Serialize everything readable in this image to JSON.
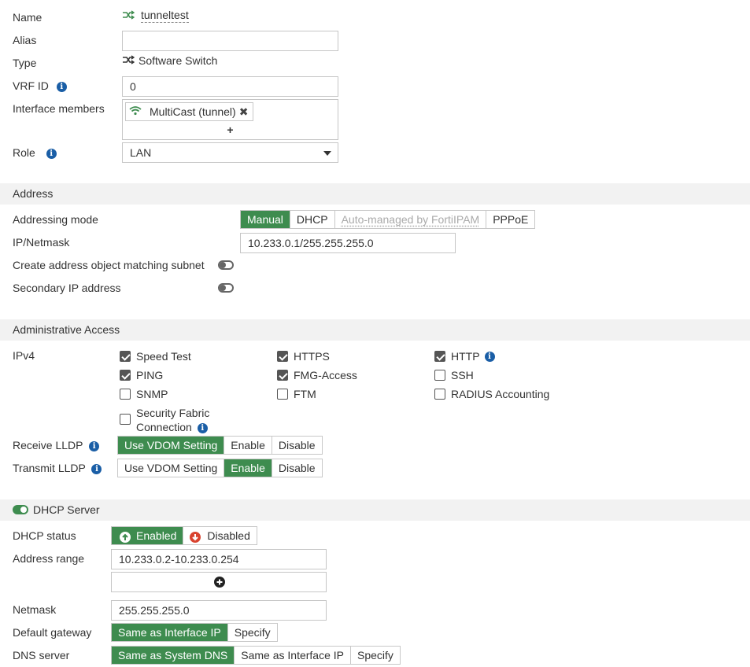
{
  "general": {
    "name_label": "Name",
    "name_value": "tunneltest",
    "alias_label": "Alias",
    "alias_value": "",
    "type_label": "Type",
    "type_value": "Software Switch",
    "vrf_label": "VRF ID",
    "vrf_value": "0",
    "members_label": "Interface members",
    "member_chip": "MultiCast (tunnel)",
    "member_add": "+",
    "role_label": "Role",
    "role_value": "LAN"
  },
  "address": {
    "header": "Address",
    "mode_label": "Addressing mode",
    "modes": [
      "Manual",
      "DHCP",
      "Auto-managed by FortiIPAM",
      "PPPoE"
    ],
    "ip_label": "IP/Netmask",
    "ip_value": "10.233.0.1/255.255.255.0",
    "create_obj_label": "Create address object matching subnet",
    "secondary_label": "Secondary IP address"
  },
  "admin": {
    "header": "Administrative Access",
    "ipv4_label": "IPv4",
    "options": {
      "speed_test": "Speed Test",
      "https": "HTTPS",
      "http": "HTTP",
      "ping": "PING",
      "fmg": "FMG-Access",
      "ssh": "SSH",
      "snmp": "SNMP",
      "ftm": "FTM",
      "radius": "RADIUS Accounting",
      "fabric_line1": "Security Fabric",
      "fabric_line2": "Connection"
    },
    "receive_lldp_label": "Receive LLDP",
    "transmit_lldp_label": "Transmit LLDP",
    "lldp_options": [
      "Use VDOM Setting",
      "Enable",
      "Disable"
    ]
  },
  "dhcp": {
    "header": "DHCP Server",
    "status_label": "DHCP status",
    "enabled": "Enabled",
    "disabled": "Disabled",
    "range_label": "Address range",
    "range_value": "10.233.0.2-10.233.0.254",
    "netmask_label": "Netmask",
    "netmask_value": "255.255.255.0",
    "gateway_label": "Default gateway",
    "gateway_options": [
      "Same as Interface IP",
      "Specify"
    ],
    "dns_label": "DNS server",
    "dns_options": [
      "Same as System DNS",
      "Same as Interface IP",
      "Specify"
    ]
  },
  "icons": {
    "info": "info-icon",
    "switch": "switch-icon",
    "wifi": "wifi-icon",
    "remove": "remove-x-icon",
    "add_circle": "add-circle-icon",
    "arrow_up": "arrow-up-circle-icon",
    "arrow_down": "arrow-down-circle-icon"
  },
  "colors": {
    "accent_green": "#3e8c4f",
    "info_blue": "#1a5ea6",
    "disabled_red": "#d9432f",
    "section_bg": "#f2f2f2"
  }
}
